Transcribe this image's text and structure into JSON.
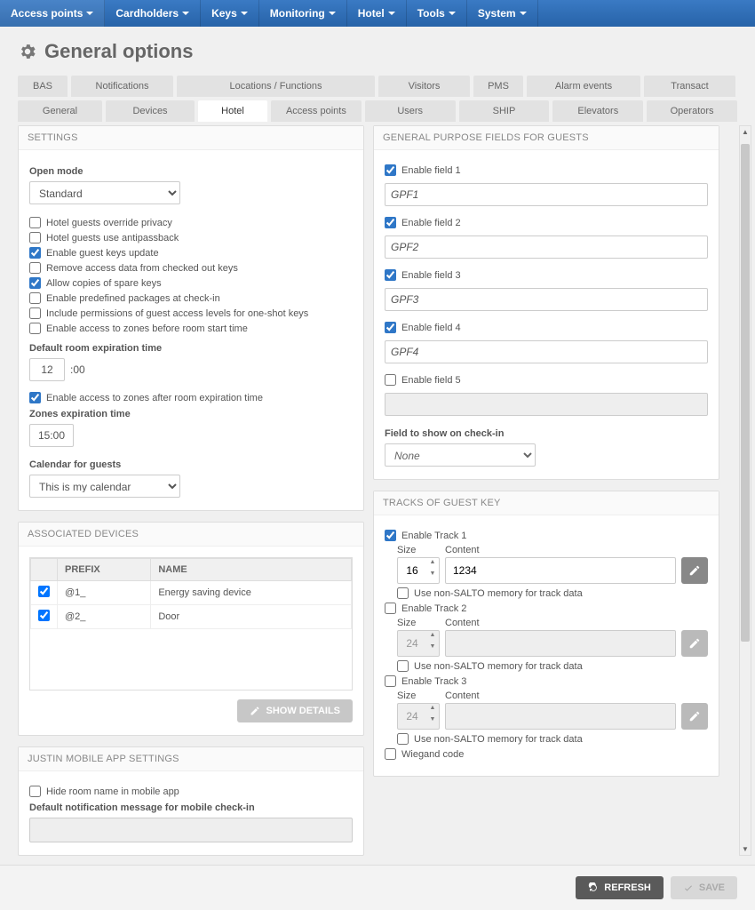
{
  "nav": [
    "Access points",
    "Cardholders",
    "Keys",
    "Monitoring",
    "Hotel",
    "Tools",
    "System"
  ],
  "page_title": "General options",
  "tabs_row1": [
    "BAS",
    "Notifications",
    "Locations / Functions",
    "Visitors",
    "PMS",
    "Alarm events",
    "Transact"
  ],
  "tabs_row2": [
    "General",
    "Devices",
    "Hotel",
    "Access points",
    "Users",
    "SHIP",
    "Elevators",
    "Operators"
  ],
  "active_tab": "Hotel",
  "settings": {
    "title": "SETTINGS",
    "open_mode_label": "Open mode",
    "open_mode_value": "Standard",
    "checks": [
      {
        "label": "Hotel guests override privacy",
        "checked": false
      },
      {
        "label": "Hotel guests use antipassback",
        "checked": false
      },
      {
        "label": "Enable guest keys update",
        "checked": true
      },
      {
        "label": "Remove access data from checked out keys",
        "checked": false
      },
      {
        "label": "Allow copies of spare keys",
        "checked": true
      },
      {
        "label": "Enable predefined packages at check-in",
        "checked": false
      },
      {
        "label": "Include permissions of guest access levels for one-shot keys",
        "checked": false
      },
      {
        "label": "Enable access to zones before room start time",
        "checked": false
      }
    ],
    "room_exp_label": "Default room expiration time",
    "room_exp_hour": "12",
    "room_exp_min": ":00",
    "zone_after_label": "Enable access to zones after room expiration time",
    "zone_after_checked": true,
    "zones_exp_label": "Zones expiration time",
    "zones_exp_value": "15:00",
    "calendar_label": "Calendar for guests",
    "calendar_value": "This is my calendar"
  },
  "devices": {
    "title": "ASSOCIATED DEVICES",
    "cols": {
      "prefix": "PREFIX",
      "name": "NAME"
    },
    "rows": [
      {
        "prefix": "@1_",
        "name": "Energy saving device",
        "checked": true
      },
      {
        "prefix": "@2_",
        "name": "Door",
        "checked": true
      }
    ],
    "show_details": "SHOW DETAILS"
  },
  "justin": {
    "title": "JUSTIN MOBILE APP SETTINGS",
    "hide_room_label": "Hide room name in mobile app",
    "hide_room_checked": false,
    "notif_label": "Default notification message for mobile check-in"
  },
  "gpf": {
    "title": "GENERAL PURPOSE FIELDS FOR GUESTS",
    "fields": [
      {
        "label": "Enable field 1",
        "value": "GPF1",
        "checked": true
      },
      {
        "label": "Enable field 2",
        "value": "GPF2",
        "checked": true
      },
      {
        "label": "Enable field 3",
        "value": "GPF3",
        "checked": true
      },
      {
        "label": "Enable field 4",
        "value": "GPF4",
        "checked": true
      },
      {
        "label": "Enable field 5",
        "value": "",
        "checked": false
      }
    ],
    "show_label": "Field to show on check-in",
    "show_value": "None"
  },
  "tracks": {
    "title": "TRACKS OF GUEST KEY",
    "size_label": "Size",
    "content_label": "Content",
    "nonsalto_label": "Use non-SALTO memory for track data",
    "items": [
      {
        "label": "Enable Track 1",
        "checked": true,
        "size": "16",
        "content": "1234",
        "nonsalto": false,
        "enabled": true
      },
      {
        "label": "Enable Track 2",
        "checked": false,
        "size": "24",
        "content": "",
        "nonsalto": false,
        "enabled": false
      },
      {
        "label": "Enable Track 3",
        "checked": false,
        "size": "24",
        "content": "",
        "nonsalto": false,
        "enabled": false
      }
    ],
    "wiegand_label": "Wiegand code",
    "wiegand_checked": false
  },
  "footer": {
    "refresh": "REFRESH",
    "save": "SAVE"
  }
}
